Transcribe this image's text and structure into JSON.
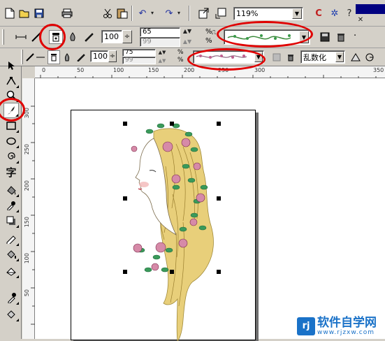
{
  "toolbar1": {
    "zoom_value": "119%",
    "watermark_text": "www.rjzxw.com"
  },
  "toolbar2": {
    "width_value": "100",
    "percent_value": "65",
    "percent_dim_value": "99",
    "percent_symbol": "%"
  },
  "toolbar3": {
    "width_value": "100",
    "percent_value": "75",
    "percent_dim_value": "99",
    "percent_symbol": "%",
    "mode_select": "乱数化"
  },
  "ruler": {
    "h_labels": [
      "0",
      "50",
      "100",
      "150",
      "200",
      "250",
      "300",
      "350"
    ],
    "v_labels": [
      "300",
      "250",
      "200",
      "150",
      "100",
      "50"
    ]
  },
  "logo": {
    "mark": "rj",
    "name": "软件自学网",
    "url": "www.rjzxw.com"
  },
  "colors": {
    "annotation_red": "#e00000",
    "title_bar_navy": "#000080",
    "logo_blue": "#1a72c8"
  },
  "icons": {
    "tool_icons": [
      "pick-tool-icon",
      "shape-tool-icon",
      "zoom-tool-icon",
      "artistic-media-tool-icon",
      "rectangle-tool-icon",
      "ellipse-tool-icon",
      "spiral-tool-icon",
      "text-tool-icon",
      "fill-tool-icon",
      "eyedropper-tool-icon",
      "shadow-tool-icon",
      "paint-bucket-tool-icon",
      "outline-tool-icon",
      "interactive-fill-icon",
      "dropper-icon",
      "bucket-icon"
    ]
  }
}
